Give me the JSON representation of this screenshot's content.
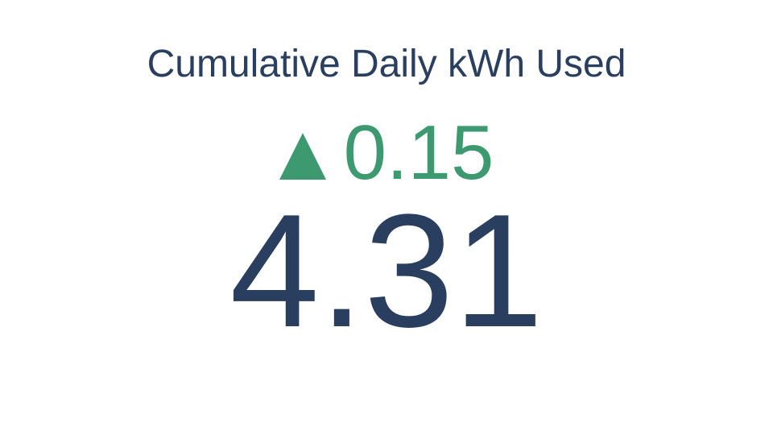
{
  "chart_data": {
    "type": "indicator",
    "title": "Cumulative Daily kWh Used",
    "value": 4.31,
    "value_text": "4.31",
    "delta": 0.15,
    "delta_text": "0.15",
    "delta_direction": "increasing",
    "delta_symbol": "triangle-up-icon",
    "colors": {
      "title": "#2a3f5f",
      "value": "#2a3f5f",
      "delta_increasing": "#3d9970",
      "background": "#ffffff"
    }
  }
}
